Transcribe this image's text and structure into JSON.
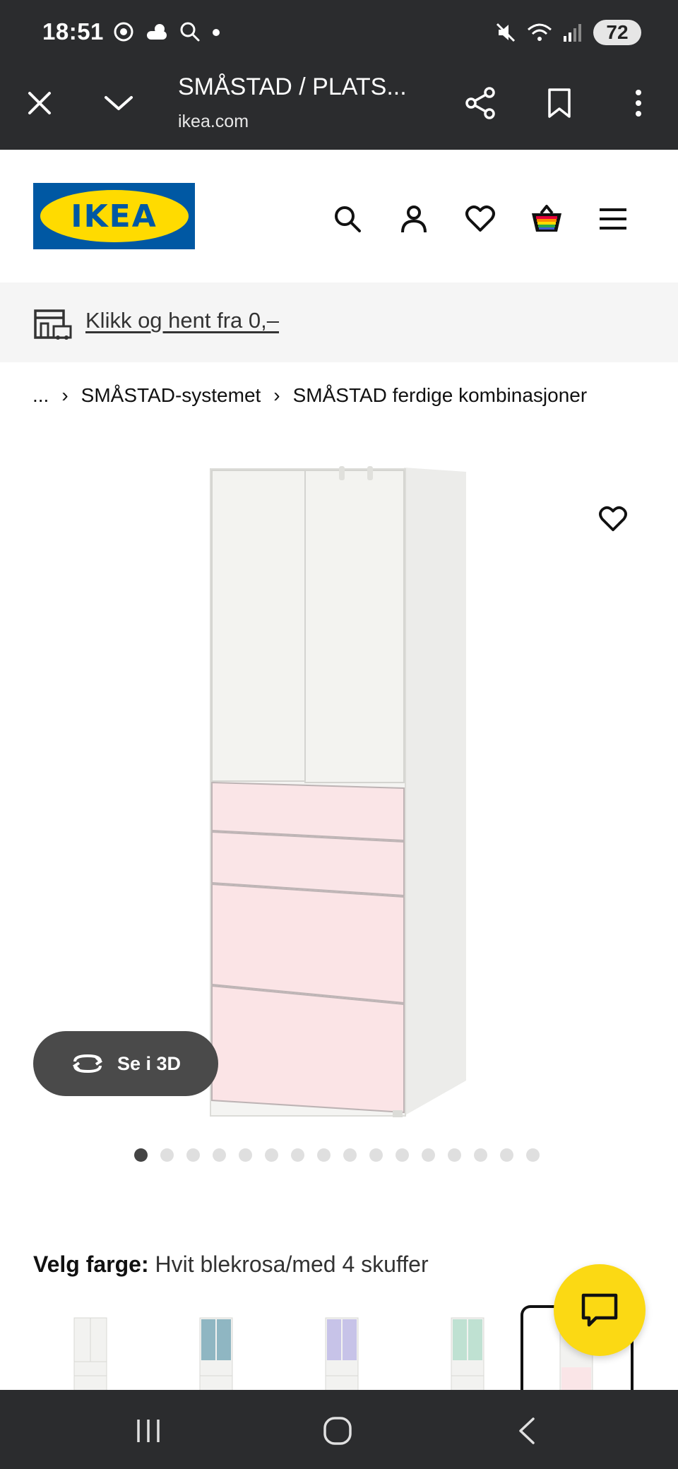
{
  "status_bar": {
    "time": "18:51",
    "battery": "72",
    "icons_left": [
      "chrome-icon",
      "weather-icon",
      "search-icon",
      "notification-dot-icon"
    ],
    "icons_right": [
      "mute-icon",
      "wifi-icon",
      "signal-icon",
      "battery-icon"
    ]
  },
  "browser": {
    "title": "SMÅSTAD / PLATS...",
    "domain": "ikea.com"
  },
  "header": {
    "logo_text": "IKEA",
    "colors": {
      "logo_blue": "#0058a3",
      "logo_yellow": "#ffdb00"
    }
  },
  "banner": {
    "text": "Klikk og hent fra 0,–"
  },
  "breadcrumb": {
    "items": [
      "...",
      "SMÅSTAD-systemet",
      "SMÅSTAD ferdige kombinasjoner"
    ]
  },
  "product": {
    "see_3d_label": "Se i 3D",
    "image_dots_total": 16,
    "image_dots_active": 1
  },
  "color_selector": {
    "label": "Velg farge:",
    "value": "Hvit blekrosa/med 4 skuffer"
  },
  "accent": {
    "chat_yellow": "#fbd914"
  }
}
